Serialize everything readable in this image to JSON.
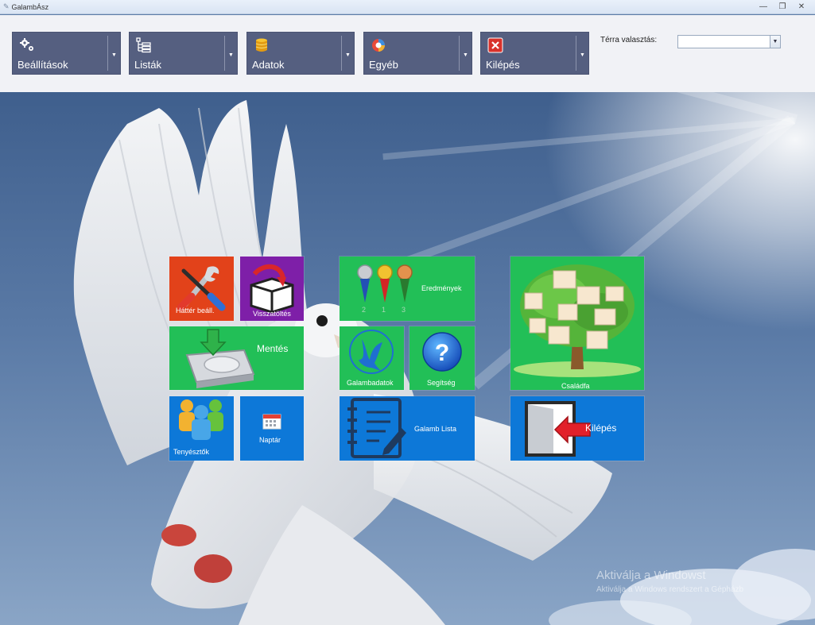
{
  "window": {
    "title": "GalambÁsz",
    "minimize_icon": "minimize-icon",
    "restore_icon": "restore-icon",
    "close_icon": "close-icon"
  },
  "toolbar": {
    "buttons": [
      {
        "label": "Beállítások",
        "icon": "gears-icon"
      },
      {
        "label": "Listák",
        "icon": "list-tree-icon"
      },
      {
        "label": "Adatok",
        "icon": "database-icon"
      },
      {
        "label": "Egyéb",
        "icon": "color-wheel-icon"
      },
      {
        "label": "Kilépés",
        "icon": "close-red-icon"
      }
    ],
    "dropdown_arrow": "▼",
    "terra_label": "Térra valasztás:",
    "terra_value": ""
  },
  "tiles": {
    "hatter": "Háttér beáll.",
    "visszatoltes": "Visszatöltés",
    "mentes": "Mentés",
    "eredmenyek": "Eredmények",
    "galambadatok": "Galambadatok",
    "segitseg": "Segítség",
    "csaladfa": "Családfa",
    "tenyesztok": "Tenyésztők",
    "naptar": "Naptár",
    "galamb_lista": "Galamb Lista",
    "kilepes": "Kilépés",
    "medal_numbers": [
      "2",
      "1",
      "3"
    ]
  },
  "colors": {
    "tile_orange": "#e2421a",
    "tile_purple": "#7e1fa8",
    "tile_green": "#22bf57",
    "tile_blue": "#0d78d8",
    "toolbar_button": "#555f80"
  },
  "watermark": {
    "line1": "Aktiválja a Windowst",
    "line2": "Aktiválja a Windows rendszert a Gépházb"
  }
}
